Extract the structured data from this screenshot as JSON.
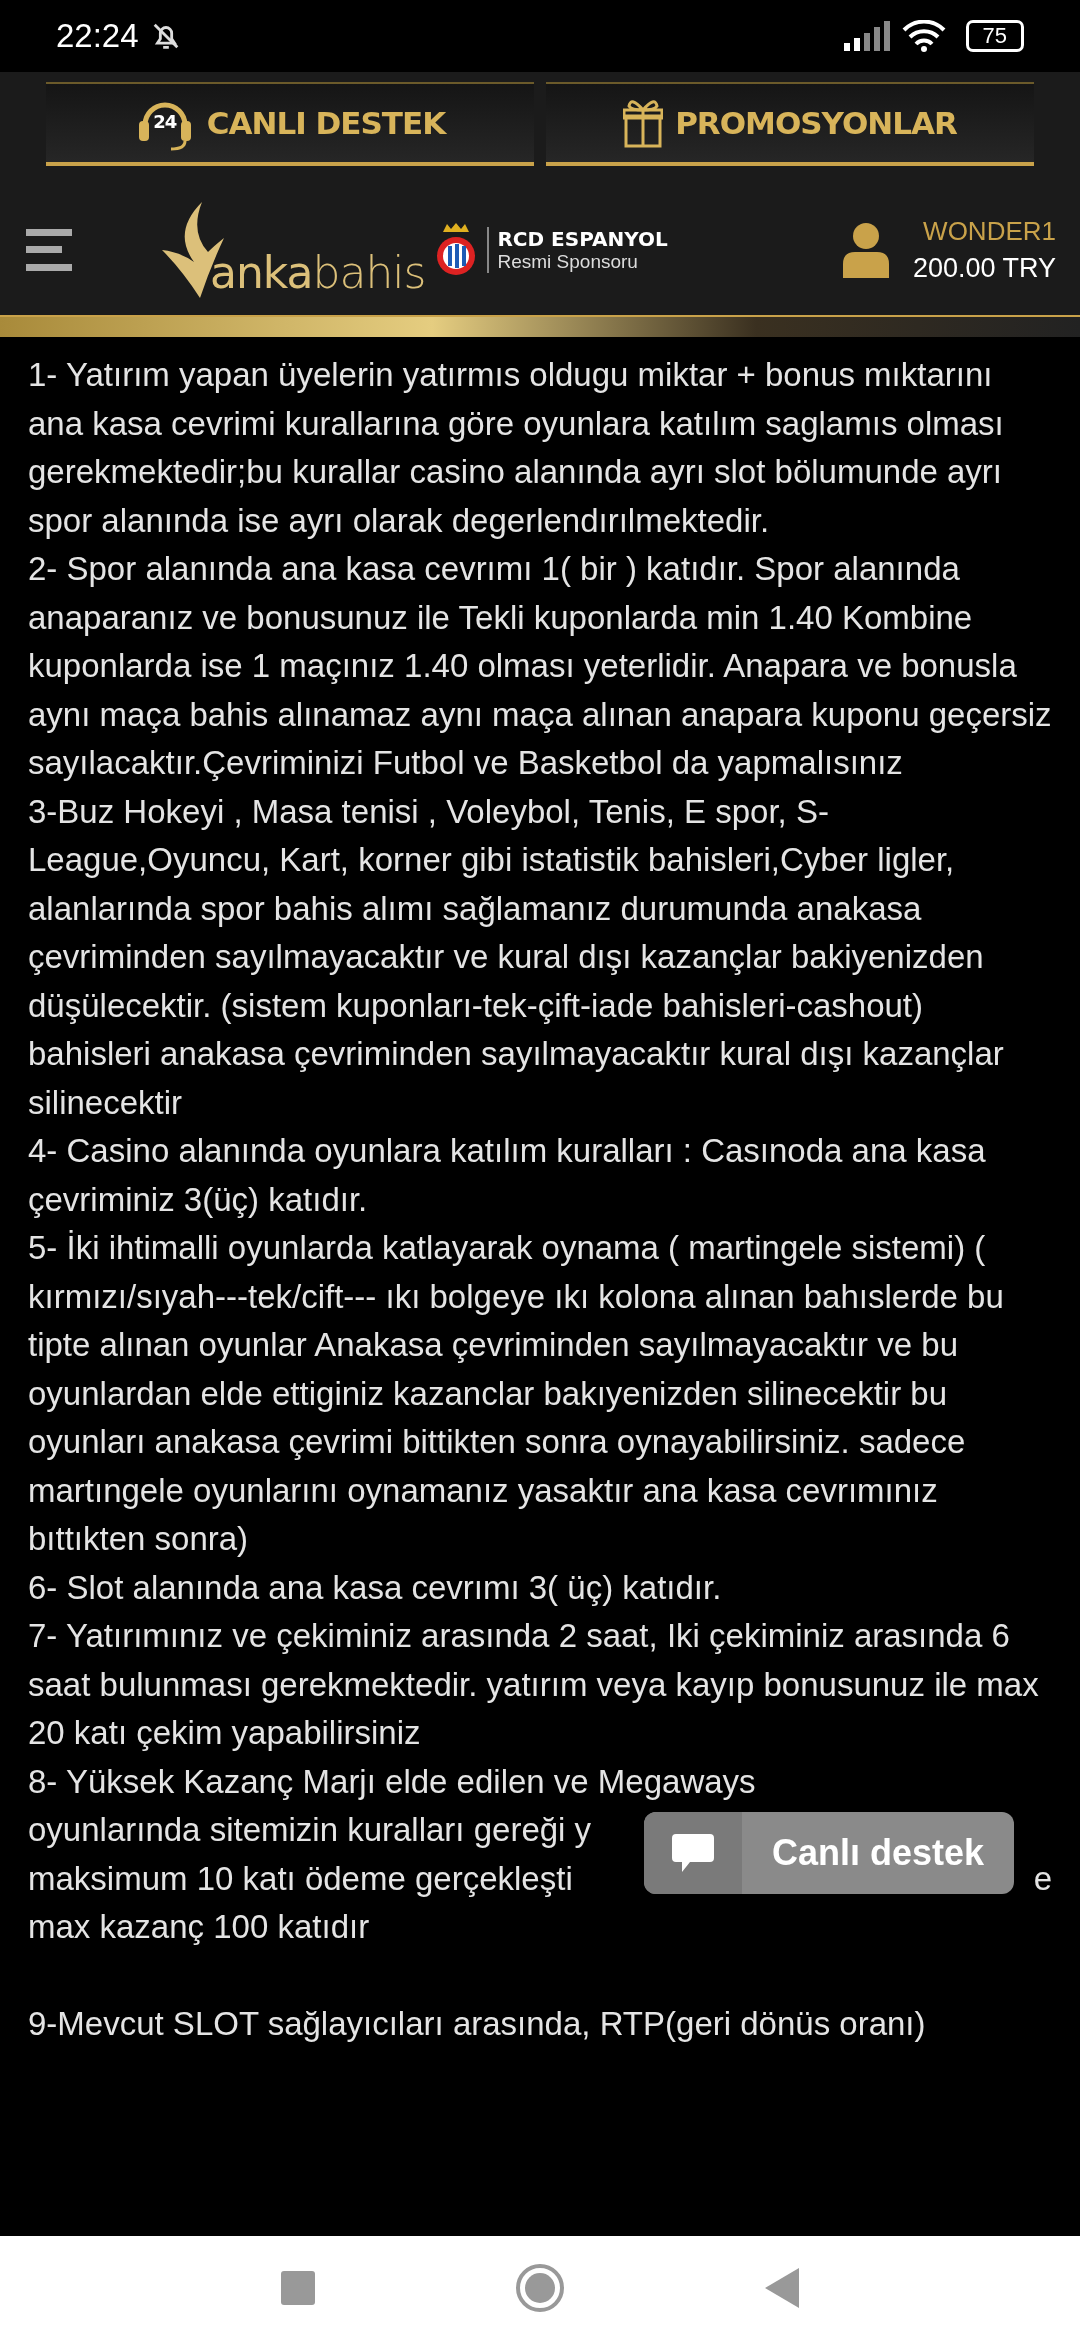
{
  "status_bar": {
    "time": "22:24",
    "battery": "75"
  },
  "top_buttons": [
    {
      "kind": "support",
      "label": "CANLI DESTEK",
      "badge": "24"
    },
    {
      "kind": "gift",
      "label": "PROMOSYONLAR"
    }
  ],
  "header": {
    "logo": "**anka**bahis",
    "sponsor_title": "RCD ESPANYOL",
    "sponsor_subtitle": "Resmi Sponsoru",
    "username": "WONDER1",
    "balance": "200.00 TRY"
  },
  "rules": [
    "1- Yatırım yapan üyelerin yatırmıs oldugu miktar + bonus mıktarını ana kasa cevrimi kurallarına göre oyunlara katılım saglamıs olması gerekmektedir;bu kurallar casino alanında ayrı slot bölumunde ayrı spor alanında ise ayrı olarak degerlendırılmektedir.",
    "2- Spor alanında ana kasa cevrımı 1( bir ) katıdır. Spor alanında anaparanız ve bonusunuz ile Tekli kuponlarda min 1.40 Kombine kuponlarda ise 1 maçınız 1.40 olması yeterlidir. Anapara ve bonusla aynı maça bahis alınamaz aynı maça alınan anapara kuponu geçersiz sayılacaktır.Çevriminizi Futbol ve Basketbol da yapmalısınız",
    "3-Buz Hokeyi , Masa tenisi , Voleybol, Tenis, E spor, S-League,Oyuncu, Kart, korner gibi istatistik bahisleri,Cyber ligler, alanlarında spor bahis alımı sağlamanız durumunda anakasa çevriminden sayılmayacaktır ve kural dışı kazançlar bakiyenizden düşülecektir. (sistem kuponları-tek-çift-iade bahisleri-cashout) bahisleri anakasa çevriminden sayılmayacaktır kural dışı kazançlar silinecektir",
    "4- Casino alanında oyunlara katılım kuralları : Casınoda ana kasa çevriminiz 3(üç) katıdır.",
    "5- İki ihtimalli oyunlarda katlayarak oynama ( martingele sistemi) ( kırmızı/sıyah---tek/cift--- ıkı bolgeye ıkı kolona alınan bahıslerde bu tipte alınan oyunlar Anakasa çevriminden sayılmayacaktır ve bu oyunlardan elde ettiginiz kazanclar bakıyenizden silinecektir bu oyunları anakasa çevrimi bittikten sonra oynayabilirsiniz. sadece martıngele oyunlarını oynamanız yasaktır ana kasa cevrımınız bıttıkten sonra)",
    "6- Slot alanında ana kasa cevrımı 3( üç) katıdır.",
    "7- Yatırımınız ve çekiminiz arasında 2 saat, Iki çekiminiz arasında 6 saat bulunması gerekmektedir. yatırım veya kayıp bonusunuz ile max 20 katı çekim yapabilirsiniz"
  ],
  "rule_8_lines": [
    {
      "left": "8- Yüksek Kazanç Marjı elde edilen ve Megaways"
    },
    {
      "left": "oyunlarında sitemizin kuralları gereği y"
    },
    {
      "left": "maksimum 10 katı ödeme gerçekleşti",
      "right": "e"
    },
    {
      "left": "max kazanç 100 katıdır"
    }
  ],
  "rule_9": "9-Mevcut SLOT sağlayıcıları arasında, RTP(geri dönüs oranı)",
  "chat_button": {
    "label": "Canlı destek"
  }
}
